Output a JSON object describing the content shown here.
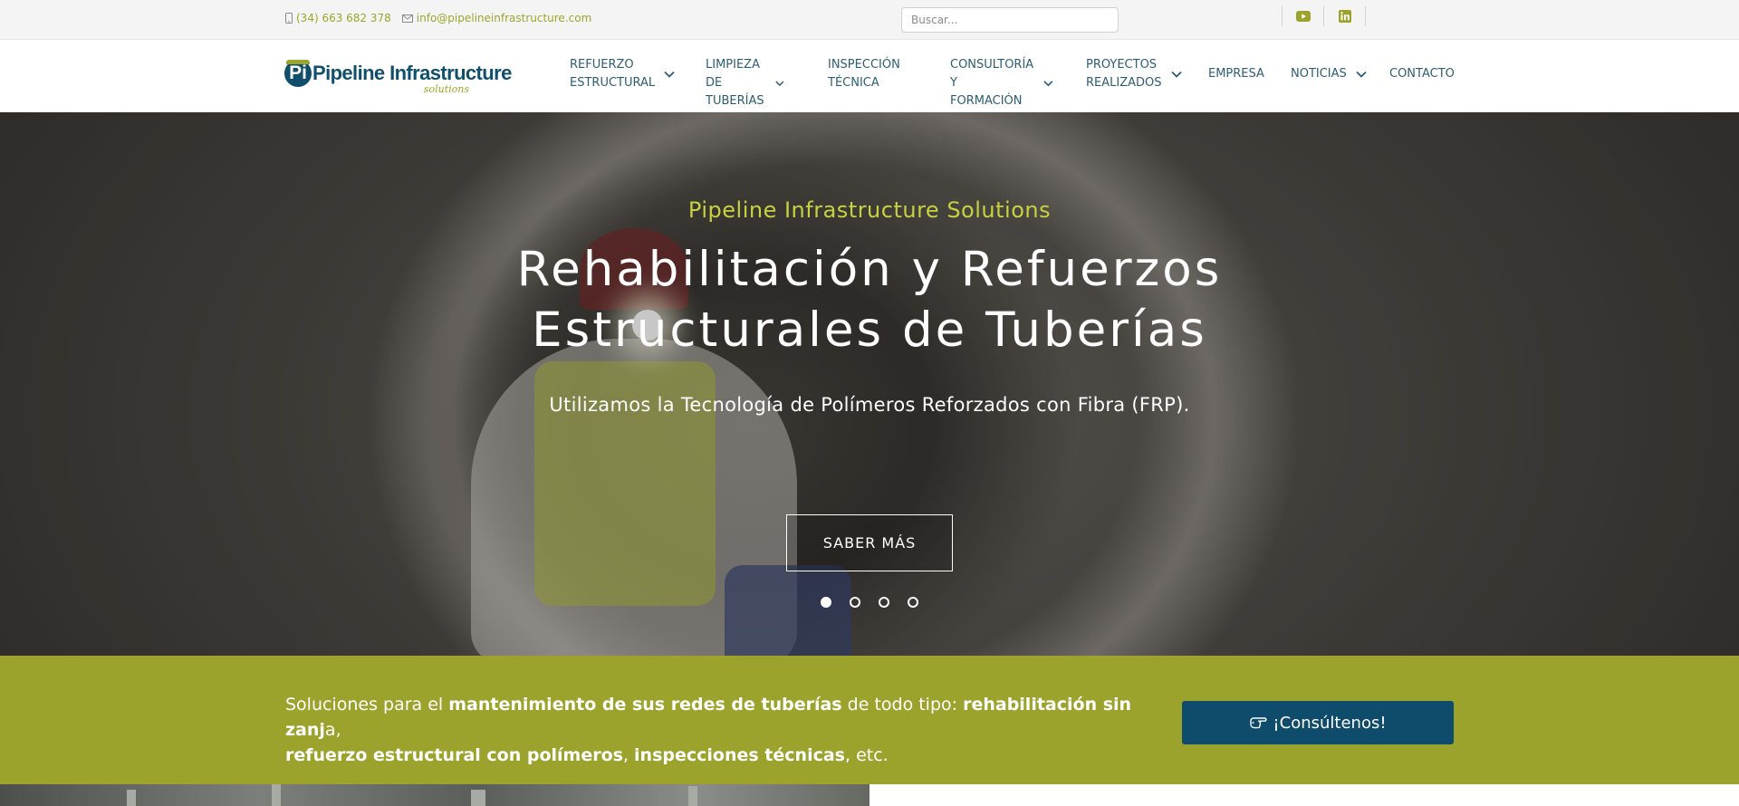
{
  "topbar": {
    "phone": "(34) 663 682 378",
    "email": "info@pipelineinfrastructure.com",
    "search_placeholder": "Buscar...",
    "social": [
      "youtube-icon",
      "linkedin-icon"
    ]
  },
  "header": {
    "logo_name": "Pipeline Infrastructure",
    "logo_tag": "solutions",
    "nav": [
      {
        "label": "REFUERZO\nESTRUCTURAL",
        "dropdown": true
      },
      {
        "label": "LIMPIEZA DE\nTUBERÍAS",
        "dropdown": true
      },
      {
        "label": "INSPECCIÓN\nTÉCNICA",
        "dropdown": false
      },
      {
        "label": "CONSULTORÍA Y\nFORMACIÓN",
        "dropdown": true
      },
      {
        "label": "PROYECTOS\nREALIZADOS",
        "dropdown": true
      },
      {
        "label": "EMPRESA",
        "dropdown": false
      },
      {
        "label": "NOTICIAS",
        "dropdown": true
      },
      {
        "label": "CONTACTO",
        "dropdown": false
      }
    ]
  },
  "hero": {
    "subtitle": "Pipeline Infrastructure Solutions",
    "title_line1": "Rehabilitación y Refuerzos",
    "title_line2": "Estructurales de Tuberías",
    "description": "Utilizamos la Tecnología de Polímeros Reforzados con Fibra (FRP).",
    "button": "SABER MÁS",
    "slides": 4,
    "active_slide": 1
  },
  "band": {
    "t1": "Soluciones para el ",
    "b1": "mantenimiento de sus redes de tuberías",
    "t2": " de todo tipo: ",
    "b2": "rehabilitación sin zanj",
    "t3": "a, ",
    "b3": "refuerzo estructural con polímeros",
    "t4": ", ",
    "b4": "inspecciones técnicas",
    "t5": ", etc.",
    "cta": "¡Consúltenos!"
  },
  "colors": {
    "accent_green": "#9ca32d",
    "brand_blue": "#0f4b6a",
    "nav_text": "#2d5d73"
  }
}
